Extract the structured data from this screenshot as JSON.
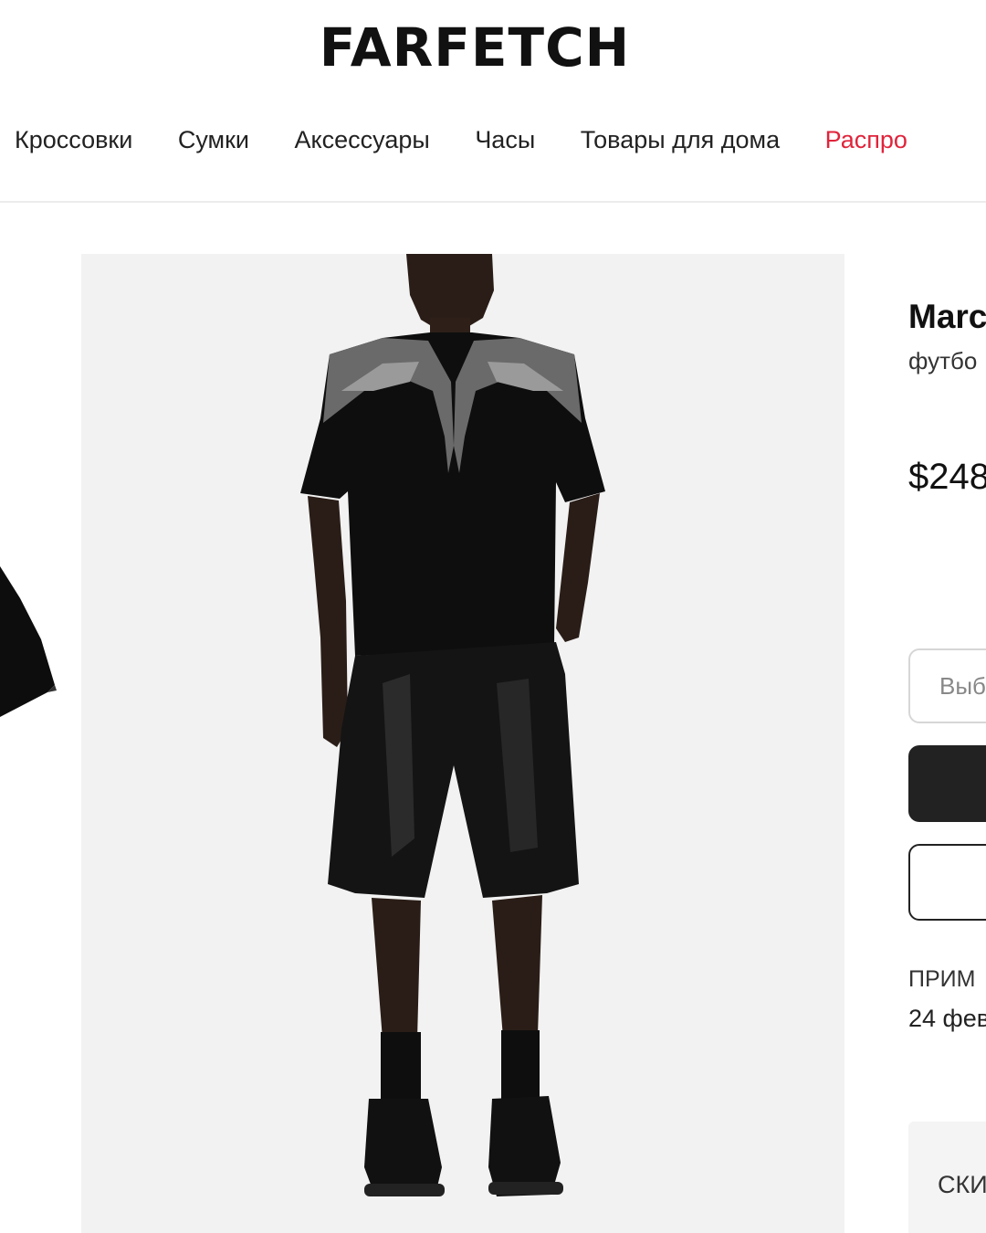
{
  "header": {
    "logo": "FARFETCH"
  },
  "nav": {
    "items": [
      {
        "label": "Кроссовки"
      },
      {
        "label": "Сумки"
      },
      {
        "label": "Аксессуары"
      },
      {
        "label": "Часы"
      },
      {
        "label": "Товары для дома"
      },
      {
        "label": "Распро"
      }
    ]
  },
  "product": {
    "brand": "Marc",
    "subtitle": "футбо",
    "price": "$248",
    "size_placeholder": "Выб",
    "delivery_label": "ПРИМ",
    "delivery_date": "24 фев",
    "promo_label": "СКИ"
  },
  "colors": {
    "sale": "#e0243b",
    "dark_button": "#222222",
    "image_background": "#f2f2f2"
  }
}
